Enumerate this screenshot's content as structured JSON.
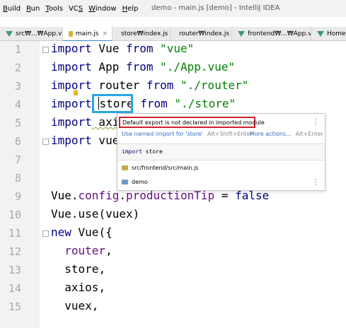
{
  "window": {
    "title": "demo - main.js [demo] - IntelliJ IDEA",
    "menu": [
      {
        "prefix": "",
        "mnemonic": "B",
        "rest": "uild"
      },
      {
        "prefix": "",
        "mnemonic": "R",
        "rest": "un"
      },
      {
        "prefix": "",
        "mnemonic": "T",
        "rest": "ools"
      },
      {
        "prefix": "VC",
        "mnemonic": "S",
        "rest": ""
      },
      {
        "prefix": "",
        "mnemonic": "W",
        "rest": "indow"
      },
      {
        "prefix": "",
        "mnemonic": "H",
        "rest": "elp"
      }
    ]
  },
  "tabs": [
    {
      "label": "src₩...₩App.vue",
      "icon": "vue-icon",
      "active": false
    },
    {
      "label": "main.js",
      "icon": "js-icon",
      "active": true
    },
    {
      "label": "store₩index.js",
      "icon": "js-icon",
      "active": false
    },
    {
      "label": "router₩index.js",
      "icon": "js-icon",
      "active": false
    },
    {
      "label": "frontend₩...₩App.vue",
      "icon": "vue-icon",
      "active": false
    },
    {
      "label": "Home.vue",
      "icon": "vue-icon",
      "active": false
    }
  ],
  "tab_close_glyph": "×",
  "editor": {
    "line_numbers": [
      "1",
      "2",
      "3",
      "4",
      "5",
      "6",
      "7",
      "8",
      "9",
      "10",
      "11",
      "12",
      "13",
      "14",
      "15"
    ],
    "l1": {
      "kw": "import",
      "id": " Vue ",
      "kw2": "from",
      "str": " \"vue\""
    },
    "l2": {
      "kw": "import",
      "id": " App ",
      "kw2": "from",
      "str": " \"./App.vue\""
    },
    "l3": {
      "kw": "import",
      "id": " router ",
      "kw2": "from",
      "str": " \"./router\""
    },
    "l4": {
      "kw": "import",
      "id": "store",
      "kw2": " from",
      "str": " \"./store\""
    },
    "l5": {
      "kw": "import",
      "id": " axi"
    },
    "l6": {
      "kw": "import",
      "id": " vue"
    },
    "l9": {
      "obj": "Vue.",
      "prop": "config",
      "dot": ".",
      "prop2": "productionTip",
      "op": " = ",
      "kw": "false"
    },
    "l10": {
      "obj": "Vue.",
      "fn": "use",
      "args": "(vuex)"
    },
    "l11": {
      "kw": "new",
      "rest": " Vue({"
    },
    "l12": {
      "prop": "router",
      "rest": ","
    },
    "l13": {
      "id": "store",
      "rest": ","
    },
    "l14": {
      "id": "axios",
      "rest": ","
    },
    "l15": {
      "id": "vuex",
      "rest": ","
    }
  },
  "popup": {
    "message": "Default export is not declared in imported module",
    "actions": [
      {
        "label": "Use named import for 'store'",
        "shortcut": "Alt+Shift+Enter"
      },
      {
        "label": "More actions...",
        "shortcut": "Alt+Enter"
      }
    ],
    "signature": {
      "kw": "import",
      "id": " store"
    },
    "location": "src/frontend/src/main.js",
    "project": "demo",
    "kebab": "⋮"
  },
  "colors": {
    "keyword": "#000080",
    "string": "#008000",
    "property": "#660e7a",
    "highlight_box": "#29a7e0",
    "error_box": "#d0202a",
    "link": "#2e6ec4"
  }
}
